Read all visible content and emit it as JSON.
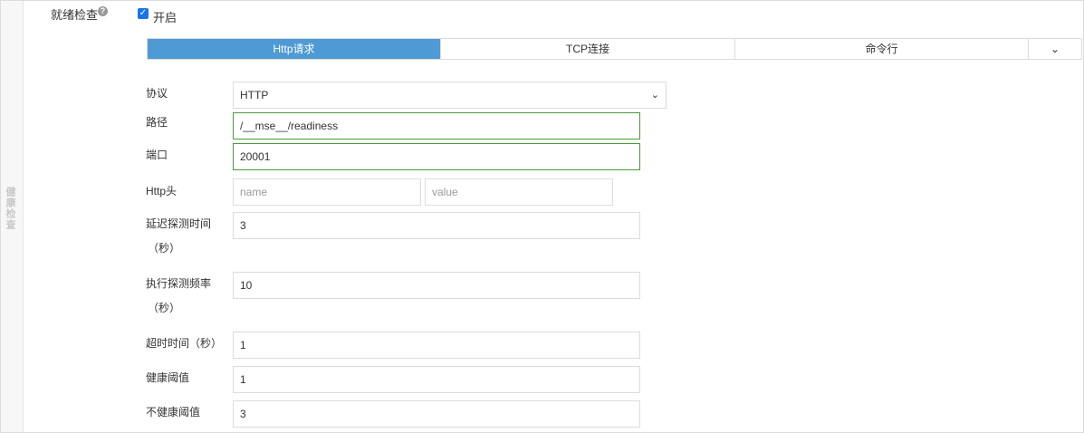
{
  "section": {
    "side_label": "健康检查"
  },
  "readiness": {
    "label": "就绪检查",
    "enable_label": "开启",
    "enabled": true,
    "help_icon": "question-circle-icon"
  },
  "tabs": [
    {
      "label": "Http请求",
      "active": true
    },
    {
      "label": "TCP连接",
      "active": false
    },
    {
      "label": "命令行",
      "active": false
    },
    {
      "label": "⌄",
      "icon": "chevron-down-icon"
    }
  ],
  "form": {
    "protocol": {
      "label": "协议",
      "value": "HTTP"
    },
    "path": {
      "label": "路径",
      "value": "/__mse__/readiness"
    },
    "port": {
      "label": "端口",
      "value": "20001"
    },
    "header": {
      "label": "Http头",
      "name_placeholder": "name",
      "value_placeholder": "value"
    },
    "initial_delay": {
      "label_line1": "延迟探测时间",
      "label_line2": "（秒）",
      "value": "3"
    },
    "period": {
      "label_line1": "执行探测频率",
      "label_line2": "（秒）",
      "value": "10"
    },
    "timeout": {
      "label": "超时时间（秒）",
      "value": "1"
    },
    "success_threshold": {
      "label": "健康阈值",
      "value": "1"
    },
    "failure_threshold": {
      "label": "不健康阈值",
      "value": "3"
    }
  }
}
